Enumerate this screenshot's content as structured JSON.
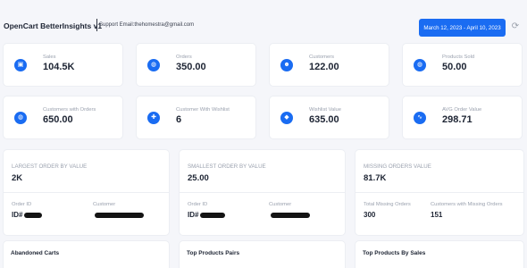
{
  "header": {
    "title": "OpenCart BetterInsights v1",
    "support": "Support Email:thehomestra@gmail.com",
    "date_range": "March 12, 2023 - April 10, 2023",
    "refresh_icon": "refresh-icon"
  },
  "stats": [
    {
      "label": "Sales",
      "value": "104.5K",
      "icon": "shopping-bag-icon"
    },
    {
      "label": "Orders",
      "value": "350.00",
      "icon": "cart-icon"
    },
    {
      "label": "Customers",
      "value": "122.00",
      "icon": "users-icon"
    },
    {
      "label": "Products Sold",
      "value": "50.00",
      "icon": "cart-icon"
    },
    {
      "label": "Customers with Orders",
      "value": "650.00",
      "icon": "cart-icon"
    },
    {
      "label": "Customer With Wishlist",
      "value": "6",
      "icon": "user-plus-icon"
    },
    {
      "label": "Wishlist Value",
      "value": "635.00",
      "icon": "tag-icon"
    },
    {
      "label": "AVG Order Value",
      "value": "298.71",
      "icon": "activity-icon"
    }
  ],
  "largest": {
    "label": "LARGEST ORDER BY VALUE",
    "value": "2K",
    "order_label": "Order ID",
    "order_value": "ID#",
    "customer_label": "Customer"
  },
  "smallest": {
    "label": "SMALLEST ORDER BY VALUE",
    "value": "25.00",
    "order_label": "Order ID",
    "order_value": "ID#",
    "customer_label": "Customer"
  },
  "missing": {
    "label": "MISSING ORDERS VALUE",
    "value": "81.7K",
    "total_label": "Total Missing Orders",
    "total_value": "300",
    "customers_label": "Customers with Missing Orders",
    "customers_value": "151"
  },
  "sections": [
    "Abandoned Carts",
    "Top Products Pairs",
    "Top Products By Sales"
  ],
  "colors": {
    "accent": "#1a6cf2",
    "background": "#f5f6fa"
  }
}
